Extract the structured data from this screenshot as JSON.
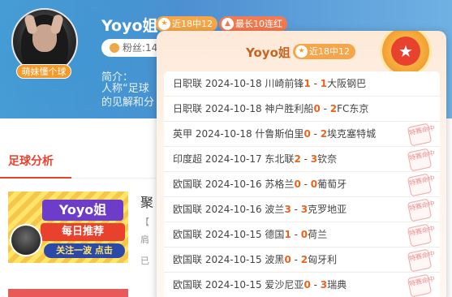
{
  "profile": {
    "name": "Yoyo姐",
    "avatar_tag": "萌妹懂个球",
    "recent_badge": "近18中12",
    "streak_badge": "最长10连红",
    "fans_label": "粉丝:14",
    "intro_label": "简介：",
    "intro_line1": "人称“足球",
    "intro_line2": "的见解和分"
  },
  "tabs": {
    "active": "足球分析"
  },
  "articles": [
    {
      "thumb_title": "Yoyo姐",
      "thumb_sub": "每日推荐",
      "thumb_cta": "关注一波 点击",
      "title": "聚",
      "line1": "【",
      "line2": "肩",
      "line3": "已"
    }
  ],
  "popup": {
    "name": "Yoyo姐",
    "recent_badge": "近18中12",
    "stamp_text": "特赛命中",
    "matches": [
      {
        "league": "日职联",
        "date": "2024-10-18",
        "home": "川崎前锋",
        "hs": "1",
        "as": "1",
        "away": "大阪钢巴",
        "hit": false
      },
      {
        "league": "日职联",
        "date": "2024-10-18",
        "home": "神户胜利船",
        "hs": "0",
        "as": "2",
        "away": "FC东京",
        "hit": false
      },
      {
        "league": "英甲",
        "date": "2024-10-18",
        "home": "什鲁斯伯里",
        "hs": "0",
        "as": "2",
        "away": "埃克塞特城",
        "hit": true
      },
      {
        "league": "印度超",
        "date": "2024-10-17",
        "home": "东北联",
        "hs": "2",
        "as": "3",
        "away": "钦奈",
        "hit": true
      },
      {
        "league": "欧国联",
        "date": "2024-10-16",
        "home": "苏格兰",
        "hs": "0",
        "as": "0",
        "away": "葡萄牙",
        "hit": true
      },
      {
        "league": "欧国联",
        "date": "2024-10-16",
        "home": "波兰",
        "hs": "3",
        "as": "3",
        "away": "克罗地亚",
        "hit": true
      },
      {
        "league": "欧国联",
        "date": "2024-10-15",
        "home": "德国",
        "hs": "1",
        "as": "0",
        "away": "荷兰",
        "hit": true
      },
      {
        "league": "欧国联",
        "date": "2024-10-15",
        "home": "波黑",
        "hs": "0",
        "as": "2",
        "away": "匈牙利",
        "hit": true
      },
      {
        "league": "欧国联",
        "date": "2024-10-15",
        "home": "爱沙尼亚",
        "hs": "0",
        "as": "3",
        "away": "瑞典",
        "hit": true
      }
    ]
  },
  "icons": {
    "recent": "star-icon",
    "streak": "flame-icon",
    "medal": "star-medal-icon",
    "fans": "fans-icon"
  },
  "colors": {
    "accent_red": "#e8412d",
    "score_orange": "#e8641f",
    "badge_orange": "#f6a648",
    "banner_blue": "#4d8fd1"
  }
}
